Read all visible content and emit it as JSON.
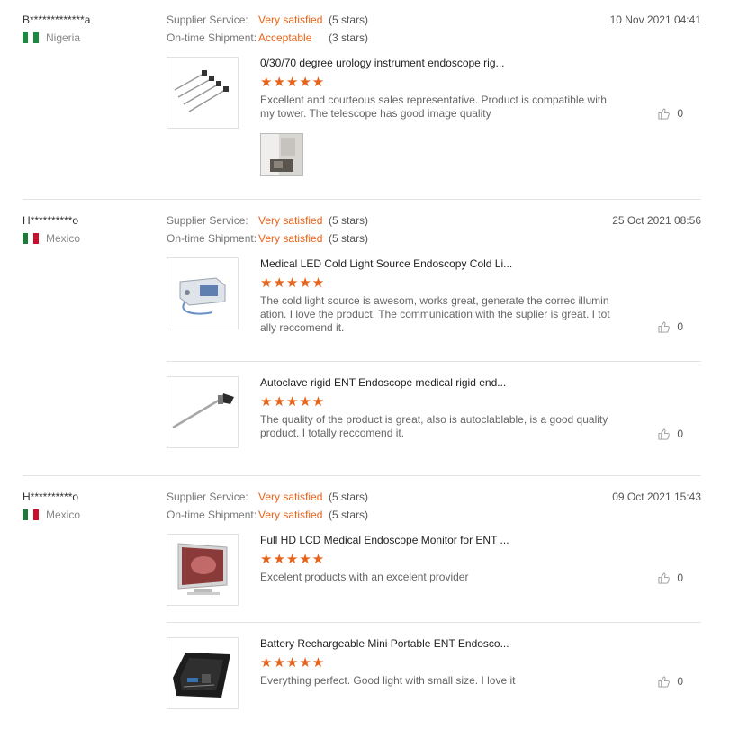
{
  "reviews": [
    {
      "user": "B*************a",
      "country": "Nigeria",
      "flag_colors": [
        "#1b8a3e",
        "#ffffff",
        "#1b8a3e"
      ],
      "date": "10 Nov 2021 04:41",
      "supplier_label": "Supplier Service:",
      "supplier_value": "Very satisfied",
      "supplier_stars": "(5 stars)",
      "shipment_label": "On-time Shipment:",
      "shipment_value": "Acceptable",
      "shipment_stars": "(3 stars)",
      "products": [
        {
          "title": "0/30/70 degree urology instrument endoscope rig...",
          "rating": "★★★★★",
          "comment": "Excellent and courteous sales representative. Product is compatible with my tower. The telescope has good image quality",
          "likes": "0",
          "thumb_icon": "endoscope-set-image",
          "has_photo": true
        }
      ]
    },
    {
      "user": "H**********o",
      "country": "Mexico",
      "flag_colors": [
        "#1f7a3a",
        "#ffffff",
        "#c8102e"
      ],
      "date": "25 Oct 2021 08:56",
      "supplier_label": "Supplier Service:",
      "supplier_value": "Very satisfied",
      "supplier_stars": "(5 stars)",
      "shipment_label": "On-time Shipment:",
      "shipment_value": "Very satisfied",
      "shipment_stars": "(5 stars)",
      "products": [
        {
          "title": "Medical LED Cold Light Source Endoscopy Cold Li...",
          "rating": "★★★★★",
          "comment": "The cold light source is awesom, works great, generate the correc illumination. I love the product. The communication with the suplier is great. I totally reccomend it.",
          "likes": "0",
          "thumb_icon": "light-source-image"
        },
        {
          "title": "Autoclave rigid ENT Endoscope medical rigid end...",
          "rating": "★★★★★",
          "comment": "The quality of the product is great, also is autoclablable, is a good quality product. I totally reccomend it.",
          "likes": "0",
          "thumb_icon": "rigid-endoscope-image"
        }
      ]
    },
    {
      "user": "H**********o",
      "country": "Mexico",
      "flag_colors": [
        "#1f7a3a",
        "#ffffff",
        "#c8102e"
      ],
      "date": "09 Oct 2021 15:43",
      "supplier_label": "Supplier Service:",
      "supplier_value": "Very satisfied",
      "supplier_stars": "(5 stars)",
      "shipment_label": "On-time Shipment:",
      "shipment_value": "Very satisfied",
      "shipment_stars": "(5 stars)",
      "products": [
        {
          "title": "Full HD LCD Medical Endoscope Monitor for ENT ...",
          "rating": "★★★★★",
          "comment": "Excelent products with an excelent provider",
          "likes": "0",
          "thumb_icon": "monitor-image"
        },
        {
          "title": "Battery Rechargeable Mini Portable ENT Endosco...",
          "rating": "★★★★★",
          "comment": "Everything perfect. Good light with small size. I love it",
          "likes": "0",
          "thumb_icon": "portable-case-image"
        }
      ]
    }
  ]
}
